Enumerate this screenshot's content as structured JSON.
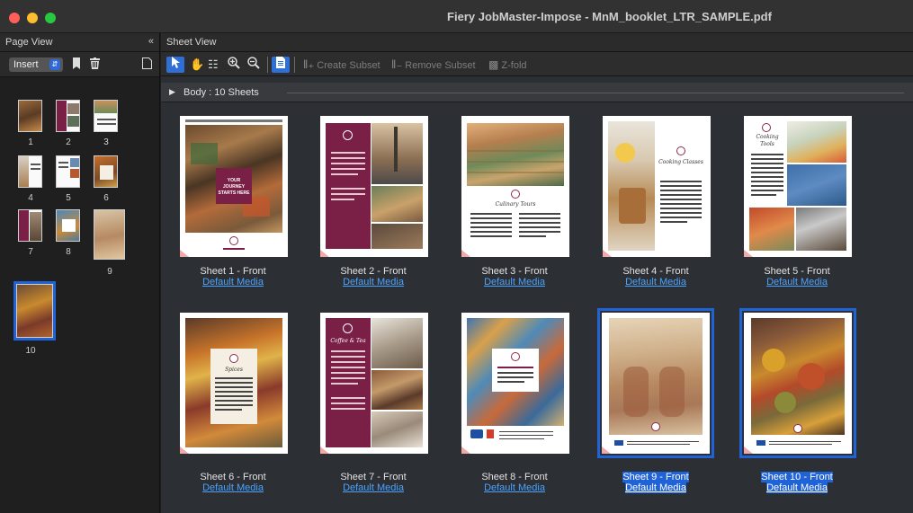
{
  "window": {
    "title": "Fiery JobMaster-Impose - MnM_booklet_LTR_SAMPLE.pdf"
  },
  "left_panel": {
    "title": "Page View",
    "collapse_icon": "double-left-chevron",
    "insert_label": "Insert",
    "icons": [
      "bookmark-icon",
      "trash-icon",
      "new-page-icon"
    ],
    "page_numbers": [
      "1",
      "2",
      "3",
      "4",
      "5",
      "6",
      "7",
      "8",
      "9",
      "10"
    ],
    "selected_page": "10"
  },
  "main_panel": {
    "title": "Sheet View",
    "toolbar": {
      "create_subset": "Create Subset",
      "remove_subset": "Remove Subset",
      "z_fold": "Z-fold"
    },
    "section_title": "Body : 10 Sheets",
    "sheets": [
      {
        "label": "Sheet 1 - Front",
        "media": "Default Media"
      },
      {
        "label": "Sheet 2 - Front",
        "media": "Default Media"
      },
      {
        "label": "Sheet 3 - Front",
        "media": "Default Media"
      },
      {
        "label": "Sheet 4 - Front",
        "media": "Default Media"
      },
      {
        "label": "Sheet 5 - Front",
        "media": "Default Media"
      },
      {
        "label": "Sheet 6 - Front",
        "media": "Default Media"
      },
      {
        "label": "Sheet 7 - Front",
        "media": "Default Media"
      },
      {
        "label": "Sheet 8 - Front",
        "media": "Default Media"
      },
      {
        "label": "Sheet 9 - Front",
        "media": "Default Media"
      },
      {
        "label": "Sheet 10 - Front",
        "media": "Default Media"
      }
    ],
    "selected_sheets": [
      "Sheet 9 - Front",
      "Sheet 10 - Front"
    ],
    "sheet_text": {
      "s1_box": "YOUR JOURNEY STARTS HERE",
      "s3_heading": "Culinary Tours",
      "s4_heading": "Cooking Classes",
      "s5_heading": "Cooking Tools",
      "s6_heading": "Spices",
      "s7_heading": "Coffee & Tea"
    }
  },
  "colors": {
    "accent": "#1f63d6",
    "link": "#4aa3ff",
    "brand_maroon": "#7a1f45"
  }
}
